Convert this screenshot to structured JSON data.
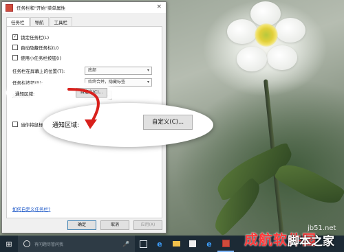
{
  "window": {
    "title": "任务栏和\"开始\"菜单属性",
    "close_icon": "×"
  },
  "tabs": [
    "任务栏",
    "导航",
    "工具栏"
  ],
  "checkboxes": [
    {
      "label": "锁定任务栏(L)",
      "checked": true
    },
    {
      "label": "自动隐藏任务栏(U)",
      "checked": false
    },
    {
      "label": "使用小任务栏按钮(I)",
      "checked": false
    }
  ],
  "fields": {
    "position_label": "任务栏在屏幕上的位置(T):",
    "position_value": "底部",
    "buttons_label": "任务栏按钮(B):",
    "buttons_value": "始终合并，隐藏标签",
    "notify_label": "通知区域:",
    "customize_label": "自定义(C)...",
    "peek_label": "当你将鼠标移"
  },
  "link": "如何自定义任务栏?",
  "footer": {
    "ok": "确定",
    "cancel": "取消",
    "apply": "应用(A)"
  },
  "callout": {
    "label": "通知区域:",
    "button": "自定义(C)..."
  },
  "taskbar": {
    "search_placeholder": "有问题尽管问我",
    "icons": [
      "windows-icon",
      "task-view-icon",
      "edge-icon",
      "file-explorer-icon",
      "store-icon",
      "ie-icon",
      "app-icon"
    ]
  },
  "watermark": {
    "brand": "脚本之家",
    "brand_red": "成航软件园",
    "site": "jb51.net"
  },
  "colors": {
    "accent": "#d8201c",
    "taskbar": "#1c2a35",
    "link": "#1a56c7"
  }
}
